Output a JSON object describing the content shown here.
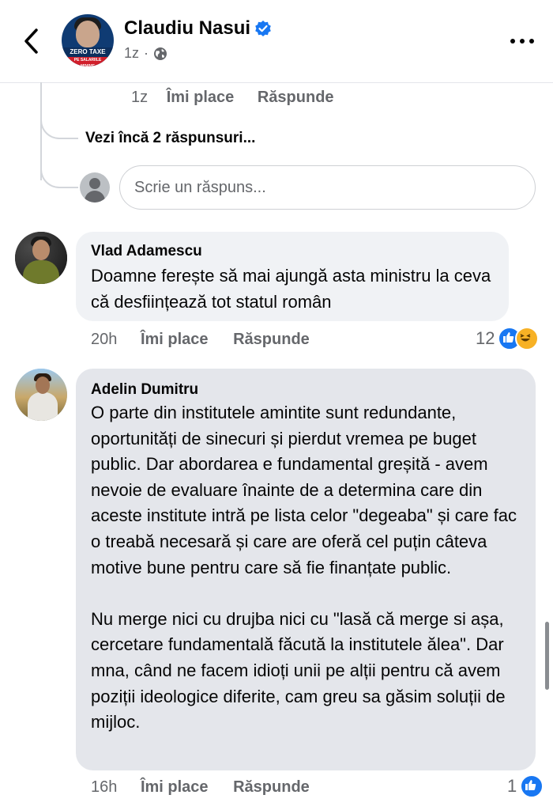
{
  "header": {
    "page_name": "Claudiu Nasui",
    "time": "1z",
    "avatar_banner_title": "ZERO TAXE",
    "avatar_banner_sub": "PE SALARIILE MINIME",
    "verified_color": "#1877f2",
    "icons": {
      "back": "chevron-left-icon",
      "verified": "verified-badge-icon",
      "audience": "globe-icon",
      "more": "more-horizontal-icon"
    }
  },
  "prev_reply": {
    "time": "1z",
    "like_label": "Îmi place",
    "reply_label": "Răspunde"
  },
  "more_replies_label": "Vezi încă 2 răspunsuri...",
  "reply_input": {
    "placeholder": "Scrie un răspuns..."
  },
  "comments": [
    {
      "author": "Vlad Adamescu",
      "text": "Doamne ferește să mai ajungă asta ministru la ceva că desființează tot statul român",
      "time": "20h",
      "like_label": "Îmi place",
      "reply_label": "Răspunde",
      "reaction_count": "12",
      "reactions": [
        "like",
        "haha"
      ]
    },
    {
      "author": "Adelin Dumitru",
      "text": "O parte din institutele amintite sunt redundante, oportunități de sinecuri și pierdut vremea pe buget public. Dar abordarea e fundamental greșită - avem nevoie de evaluare înainte de a determina care din aceste institute intră pe lista celor \"degeaba\" și care fac o treabă necesară și care are oferă cel puțin câteva motive bune pentru care să fie finanțate public.\n\nNu merge nici cu drujba nici cu \"lasă că merge si așa, cercetare fundamentală făcută la institutele ălea\". Dar mna, când ne facem idioți unii pe alții pentru că avem poziții ideologice diferite, cam greu sa găsim soluții de mijloc.",
      "time": "16h",
      "like_label": "Îmi place",
      "reply_label": "Răspunde",
      "reaction_count": "1",
      "reactions": [
        "like"
      ]
    }
  ],
  "colors": {
    "accent": "#1877f2",
    "secondary_text": "#65676b",
    "bubble": "#f0f2f5",
    "bubble_selected": "#e4e6eb"
  }
}
